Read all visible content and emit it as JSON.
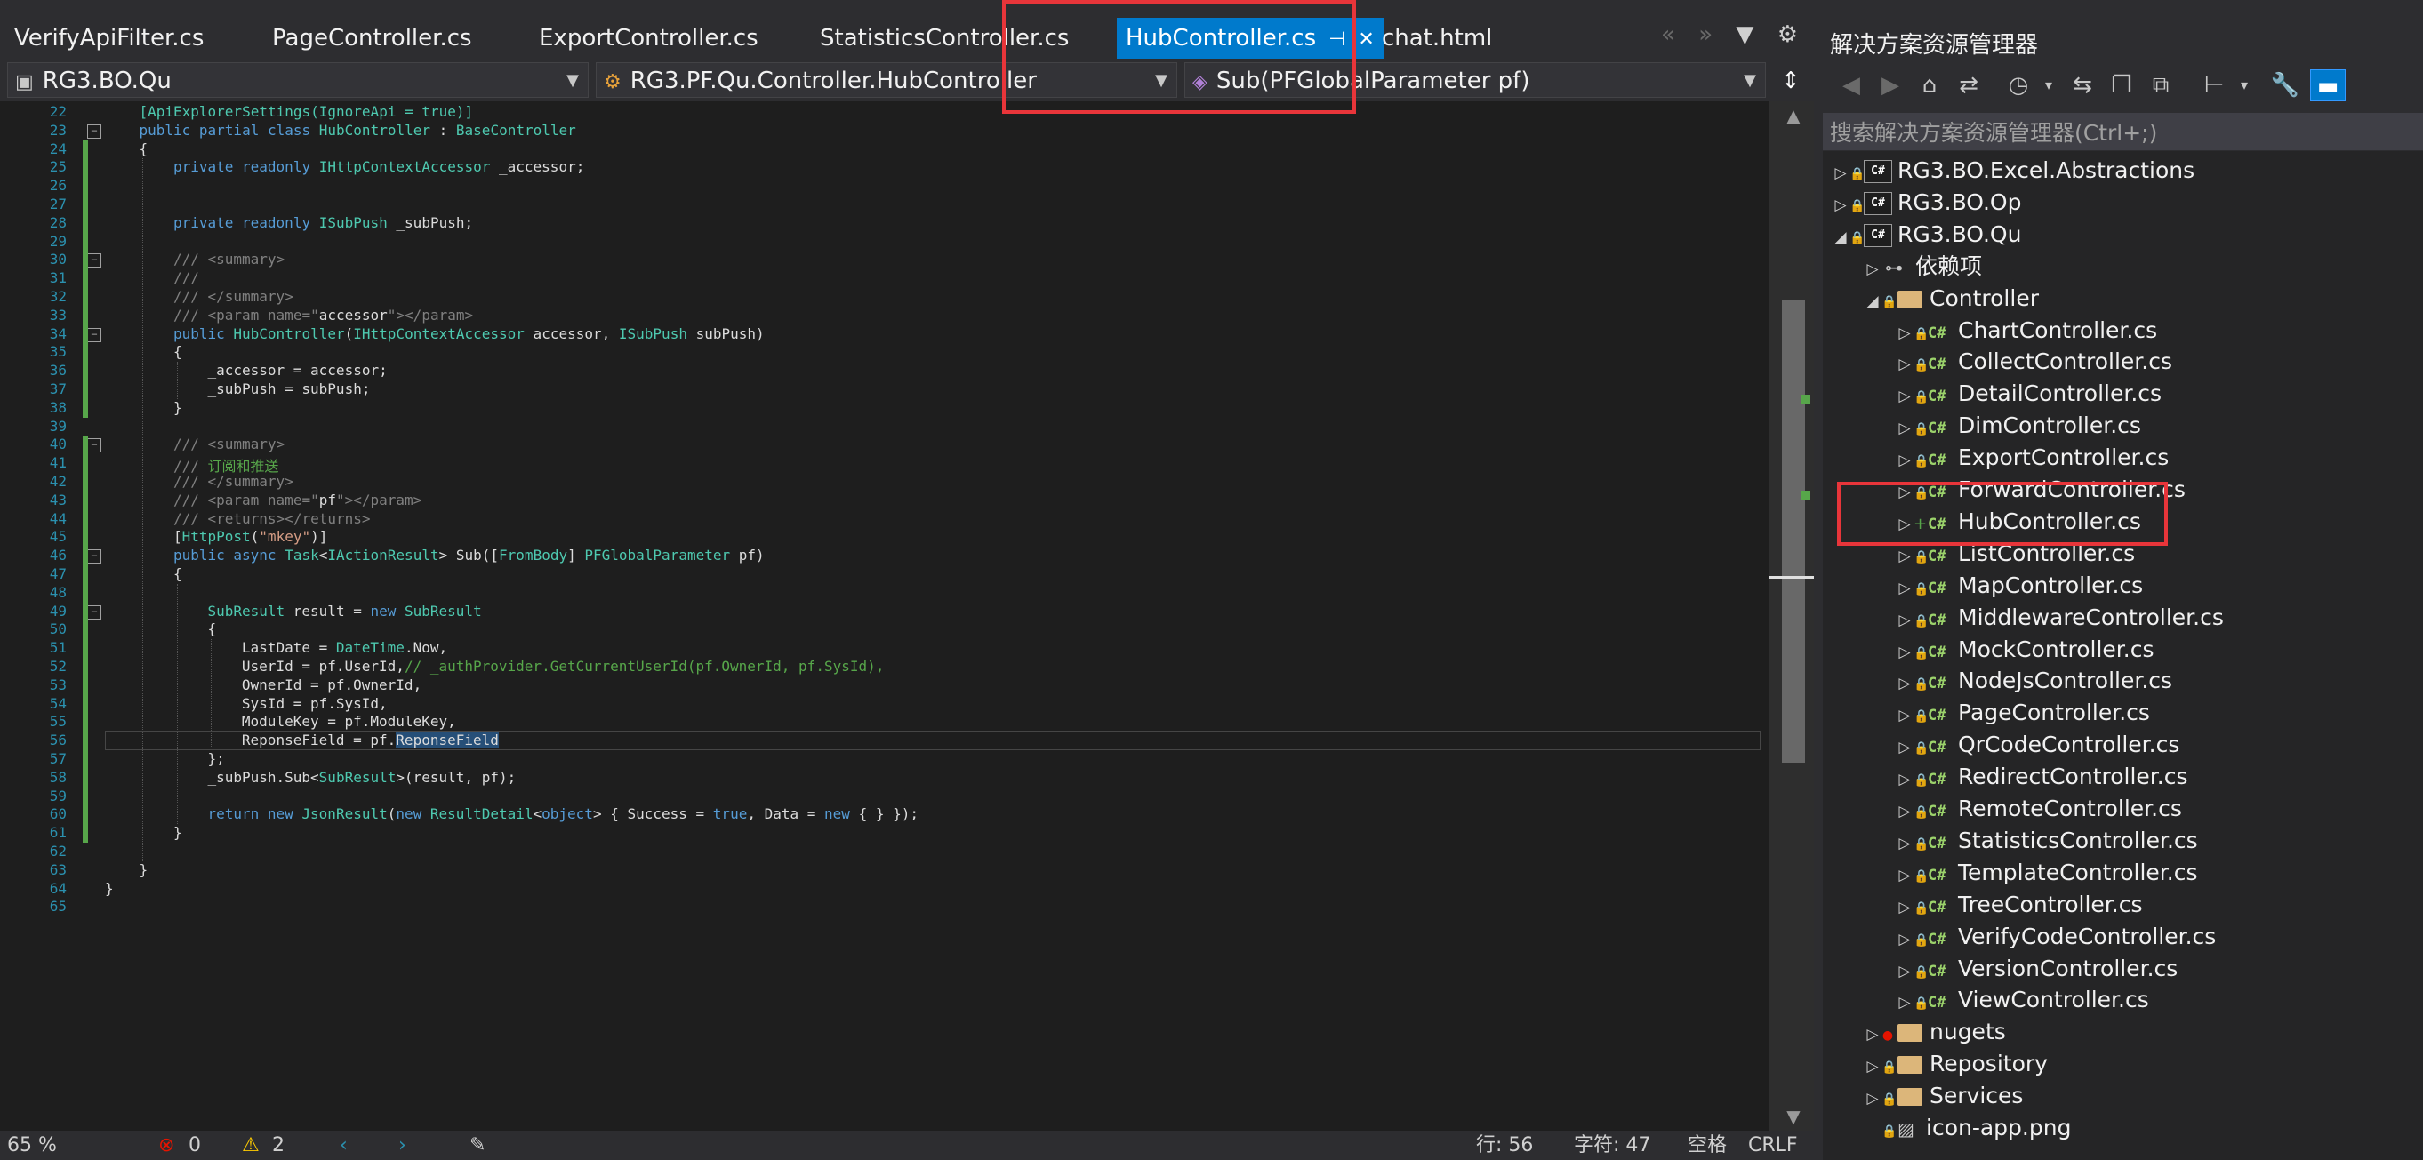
{
  "editor": {
    "tabs": [
      {
        "label": "VerifyApiFilter.cs",
        "active": false
      },
      {
        "label": "PageController.cs",
        "active": false
      },
      {
        "label": "ExportController.cs",
        "active": false
      },
      {
        "label": "StatisticsController.cs",
        "active": false
      },
      {
        "label": "HubController.cs",
        "active": true
      },
      {
        "label": "chat.html",
        "active": false
      }
    ],
    "nav": {
      "project": "RG3.BO.Qu",
      "class_path": "RG3.PF.Qu.Controller.HubController",
      "member": "Sub(PFGlobalParameter pf)"
    },
    "code_lines": [
      {
        "n": 22,
        "indent": 2,
        "html": "<span class=\"ty\">[ApiExplorerSettings(IgnoreApi = true)]</span>"
      },
      {
        "n": 23,
        "indent": 2,
        "html": "<span class=\"kw\">public partial class </span><span class=\"ty\">HubController</span> : <span class=\"ty\">BaseController</span>"
      },
      {
        "n": 24,
        "indent": 2,
        "html": "{"
      },
      {
        "n": 25,
        "indent": 4,
        "html": "<span class=\"kw\">private readonly </span><span class=\"ty\">IHttpContextAccessor</span> _accessor;"
      },
      {
        "n": 26,
        "indent": 0,
        "html": ""
      },
      {
        "n": 27,
        "indent": 0,
        "html": ""
      },
      {
        "n": 28,
        "indent": 4,
        "html": "<span class=\"kw\">private readonly </span><span class=\"ty\">ISubPush</span> _subPush;"
      },
      {
        "n": 29,
        "indent": 0,
        "html": ""
      },
      {
        "n": 30,
        "indent": 4,
        "html": "<span class=\"xm\">/// &lt;summary&gt;</span>"
      },
      {
        "n": 31,
        "indent": 4,
        "html": "<span class=\"xm\">///</span>"
      },
      {
        "n": 32,
        "indent": 4,
        "html": "<span class=\"xm\">/// &lt;/summary&gt;</span>"
      },
      {
        "n": 33,
        "indent": 4,
        "html": "<span class=\"xm\">/// &lt;param name=\"</span>accessor<span class=\"xm\">\"&gt;&lt;/param&gt;</span>"
      },
      {
        "n": 34,
        "indent": 4,
        "html": "<span class=\"kw\">public </span><span class=\"ty\">HubController</span>(<span class=\"ty\">IHttpContextAccessor</span> accessor, <span class=\"ty\">ISubPush</span> subPush)"
      },
      {
        "n": 35,
        "indent": 4,
        "html": "{"
      },
      {
        "n": 36,
        "indent": 6,
        "html": "_accessor = accessor;"
      },
      {
        "n": 37,
        "indent": 6,
        "html": "_subPush = subPush;"
      },
      {
        "n": 38,
        "indent": 4,
        "html": "}"
      },
      {
        "n": 39,
        "indent": 0,
        "html": ""
      },
      {
        "n": 40,
        "indent": 4,
        "html": "<span class=\"xm\">/// &lt;summary&gt;</span>"
      },
      {
        "n": 41,
        "indent": 4,
        "html": "<span class=\"xm\">/// </span><span class=\"cm\">订阅和推送</span>"
      },
      {
        "n": 42,
        "indent": 4,
        "html": "<span class=\"xm\">/// &lt;/summary&gt;</span>"
      },
      {
        "n": 43,
        "indent": 4,
        "html": "<span class=\"xm\">/// &lt;param name=\"</span>pf<span class=\"xm\">\"&gt;&lt;/param&gt;</span>"
      },
      {
        "n": 44,
        "indent": 4,
        "html": "<span class=\"xm\">/// &lt;returns&gt;&lt;/returns&gt;</span>"
      },
      {
        "n": 45,
        "indent": 4,
        "html": "[<span class=\"ty\">HttpPost</span>(<span class=\"st\">\"mkey\"</span>)]"
      },
      {
        "n": 46,
        "indent": 4,
        "html": "<span class=\"kw\">public async </span><span class=\"ty\">Task</span>&lt;<span class=\"ty\">IActionResult</span>&gt; Sub([<span class=\"ty\">FromBody</span>] <span class=\"ty\">PFGlobalParameter</span> pf)"
      },
      {
        "n": 47,
        "indent": 4,
        "html": "{"
      },
      {
        "n": 48,
        "indent": 0,
        "html": ""
      },
      {
        "n": 49,
        "indent": 6,
        "html": "<span class=\"ty\">SubResult</span> result = <span class=\"kw\">new </span><span class=\"ty\">SubResult</span>"
      },
      {
        "n": 50,
        "indent": 6,
        "html": "{"
      },
      {
        "n": 51,
        "indent": 8,
        "html": "LastDate = <span class=\"ty\">DateTime</span>.Now,"
      },
      {
        "n": 52,
        "indent": 8,
        "html": "UserId = pf.UserId,<span class=\"cm\">// _authProvider.GetCurrentUserId(pf.OwnerId, pf.SysId),</span>"
      },
      {
        "n": 53,
        "indent": 8,
        "html": "OwnerId = pf.OwnerId,"
      },
      {
        "n": 54,
        "indent": 8,
        "html": "SysId = pf.SysId,"
      },
      {
        "n": 55,
        "indent": 8,
        "html": "ModuleKey = pf.ModuleKey,"
      },
      {
        "n": 56,
        "indent": 8,
        "html": "ReponseField = pf.<span class=\"sel\">ReponseField</span>"
      },
      {
        "n": 57,
        "indent": 6,
        "html": "};"
      },
      {
        "n": 58,
        "indent": 6,
        "html": "_subPush.Sub&lt;<span class=\"ty\">SubResult</span>&gt;(result, pf);"
      },
      {
        "n": 59,
        "indent": 0,
        "html": ""
      },
      {
        "n": 60,
        "indent": 6,
        "html": "<span class=\"kw\">return new </span><span class=\"ty\">JsonResult</span>(<span class=\"kw\">new </span><span class=\"ty\">ResultDetail</span>&lt;<span class=\"kw\">object</span>&gt; { Success = <span class=\"kw\">true</span>, Data = <span class=\"kw\">new</span> { } });"
      },
      {
        "n": 61,
        "indent": 4,
        "html": "}"
      },
      {
        "n": 62,
        "indent": 0,
        "html": ""
      },
      {
        "n": 63,
        "indent": 2,
        "html": "}"
      },
      {
        "n": 64,
        "indent": 0,
        "html": "}"
      },
      {
        "n": 65,
        "indent": 0,
        "html": ""
      }
    ],
    "fold_lines": [
      23,
      30,
      34,
      40,
      46,
      49
    ],
    "status": {
      "zoom": "65 %",
      "errors": "0",
      "warnings": "2",
      "position": "行: 56",
      "column": "字符: 47",
      "mode": "空格",
      "encoding": "CRLF"
    }
  },
  "solution_explorer": {
    "title": "解决方案资源管理器",
    "search_placeholder": "搜索解决方案资源管理器(Ctrl+;)",
    "items": [
      {
        "label": "RG3.BO.Excel.Abstractions",
        "level": 0,
        "kind": "project",
        "expander": "▷",
        "marker": "lock"
      },
      {
        "label": "RG3.BO.Op",
        "level": 0,
        "kind": "project",
        "expander": "▷",
        "marker": "lock"
      },
      {
        "label": "RG3.BO.Qu",
        "level": 0,
        "kind": "project",
        "expander": "◢",
        "marker": "lock"
      },
      {
        "label": "依赖项",
        "level": 1,
        "kind": "dependencies",
        "expander": "▷",
        "marker": ""
      },
      {
        "label": "Controller",
        "level": 1,
        "kind": "folder",
        "expander": "◢",
        "marker": "lock"
      },
      {
        "label": "ChartController.cs",
        "level": 2,
        "kind": "cs",
        "expander": "▷",
        "marker": "lock"
      },
      {
        "label": "CollectController.cs",
        "level": 2,
        "kind": "cs",
        "expander": "▷",
        "marker": "lock"
      },
      {
        "label": "DetailController.cs",
        "level": 2,
        "kind": "cs",
        "expander": "▷",
        "marker": "lock"
      },
      {
        "label": "DimController.cs",
        "level": 2,
        "kind": "cs",
        "expander": "▷",
        "marker": "lock"
      },
      {
        "label": "ExportController.cs",
        "level": 2,
        "kind": "cs",
        "expander": "▷",
        "marker": "lock"
      },
      {
        "label": "ForwardController.cs",
        "level": 2,
        "kind": "cs",
        "expander": "▷",
        "marker": "lock"
      },
      {
        "label": "HubController.cs",
        "level": 2,
        "kind": "cs",
        "expander": "▷",
        "marker": "plus"
      },
      {
        "label": "ListController.cs",
        "level": 2,
        "kind": "cs",
        "expander": "▷",
        "marker": "lock"
      },
      {
        "label": "MapController.cs",
        "level": 2,
        "kind": "cs",
        "expander": "▷",
        "marker": "lock"
      },
      {
        "label": "MiddlewareController.cs",
        "level": 2,
        "kind": "cs",
        "expander": "▷",
        "marker": "lock"
      },
      {
        "label": "MockController.cs",
        "level": 2,
        "kind": "cs",
        "expander": "▷",
        "marker": "lock"
      },
      {
        "label": "NodeJsController.cs",
        "level": 2,
        "kind": "cs",
        "expander": "▷",
        "marker": "lock"
      },
      {
        "label": "PageController.cs",
        "level": 2,
        "kind": "cs",
        "expander": "▷",
        "marker": "lock"
      },
      {
        "label": "QrCodeController.cs",
        "level": 2,
        "kind": "cs",
        "expander": "▷",
        "marker": "lock"
      },
      {
        "label": "RedirectController.cs",
        "level": 2,
        "kind": "cs",
        "expander": "▷",
        "marker": "lock"
      },
      {
        "label": "RemoteController.cs",
        "level": 2,
        "kind": "cs",
        "expander": "▷",
        "marker": "lock"
      },
      {
        "label": "StatisticsController.cs",
        "level": 2,
        "kind": "cs",
        "expander": "▷",
        "marker": "lock"
      },
      {
        "label": "TemplateController.cs",
        "level": 2,
        "kind": "cs",
        "expander": "▷",
        "marker": "lock"
      },
      {
        "label": "TreeController.cs",
        "level": 2,
        "kind": "cs",
        "expander": "▷",
        "marker": "lock"
      },
      {
        "label": "VerifyCodeController.cs",
        "level": 2,
        "kind": "cs",
        "expander": "▷",
        "marker": "lock"
      },
      {
        "label": "VersionController.cs",
        "level": 2,
        "kind": "cs",
        "expander": "▷",
        "marker": "lock"
      },
      {
        "label": "ViewController.cs",
        "level": 2,
        "kind": "cs",
        "expander": "▷",
        "marker": "lock"
      },
      {
        "label": "nugets",
        "level": 1,
        "kind": "folder",
        "expander": "▷",
        "marker": "red"
      },
      {
        "label": "Repository",
        "level": 1,
        "kind": "folder",
        "expander": "▷",
        "marker": "lock"
      },
      {
        "label": "Services",
        "level": 1,
        "kind": "folder",
        "expander": "▷",
        "marker": "lock"
      },
      {
        "label": "icon-app.png",
        "level": 1,
        "kind": "image",
        "expander": "",
        "marker": "lock"
      }
    ]
  },
  "colors": {
    "accent": "#007acc",
    "annotation": "#e8353a",
    "change_bar": "#57a64a"
  }
}
